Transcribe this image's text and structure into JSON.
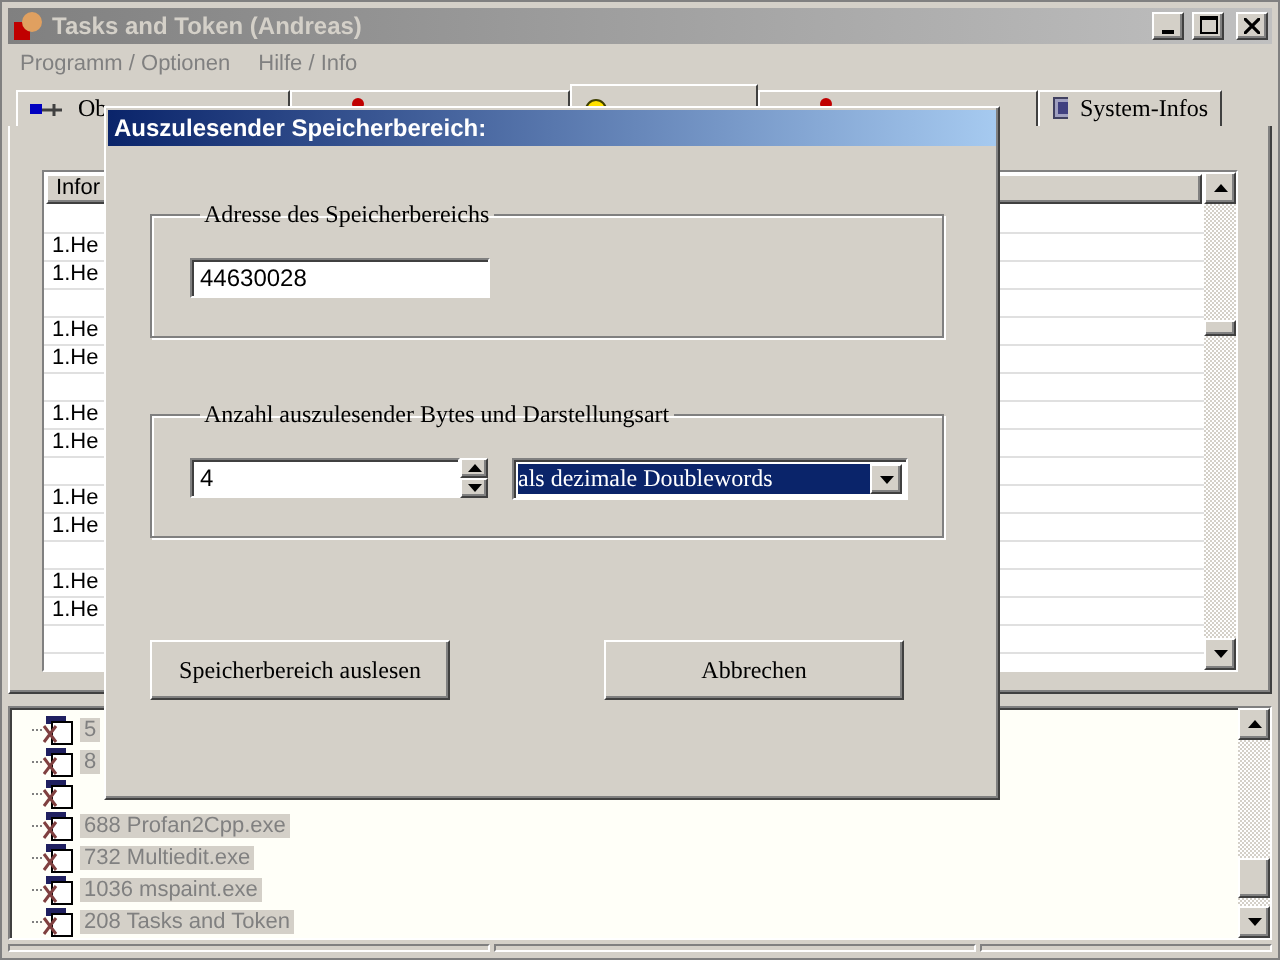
{
  "window": {
    "title": "Tasks and Token  (Andreas)",
    "active": false
  },
  "menu": [
    "Programm / Optionen",
    "Hilfe / Info"
  ],
  "tabs": [
    {
      "label": "Ob",
      "kind": "cable",
      "selected": false
    },
    {
      "kind": "person",
      "selected": false
    },
    {
      "kind": "bulb",
      "selected": true
    },
    {
      "kind": "person",
      "selected": false
    },
    {
      "label": "System-Infos",
      "kind": "monitor",
      "selected": false
    }
  ],
  "list": {
    "header": "Infor",
    "groups": [
      [
        "1.He",
        "1.He"
      ],
      [
        "1.He",
        "1.He"
      ],
      [
        "1.He",
        "1.He"
      ],
      [
        "1.He",
        "1.He"
      ],
      [
        "1.He",
        "1.He"
      ]
    ]
  },
  "tree": {
    "items": [
      {
        "kind": "item",
        "label": "5"
      },
      {
        "kind": "item",
        "label": "8"
      },
      {
        "kind": "covered"
      },
      {
        "kind": "item",
        "label": "688 Profan2Cpp.exe"
      },
      {
        "kind": "item",
        "label": "732 Multiedit.exe"
      },
      {
        "kind": "item",
        "label": "1036 mspaint.exe"
      },
      {
        "kind": "item",
        "label": "208 Tasks and Token"
      }
    ]
  },
  "dialog": {
    "title": "Auszulesender Speicherbereich:",
    "address_group": {
      "legend": "Adresse des Speicherbereichs",
      "value": "44630028"
    },
    "count_group": {
      "legend": "Anzahl auszulesender Bytes und Darstellungsart",
      "count": "4",
      "format": "als dezimale Doublewords",
      "format_focused": true
    },
    "buttons": [
      "Speicherbereich auslesen",
      "Abbrechen"
    ]
  }
}
